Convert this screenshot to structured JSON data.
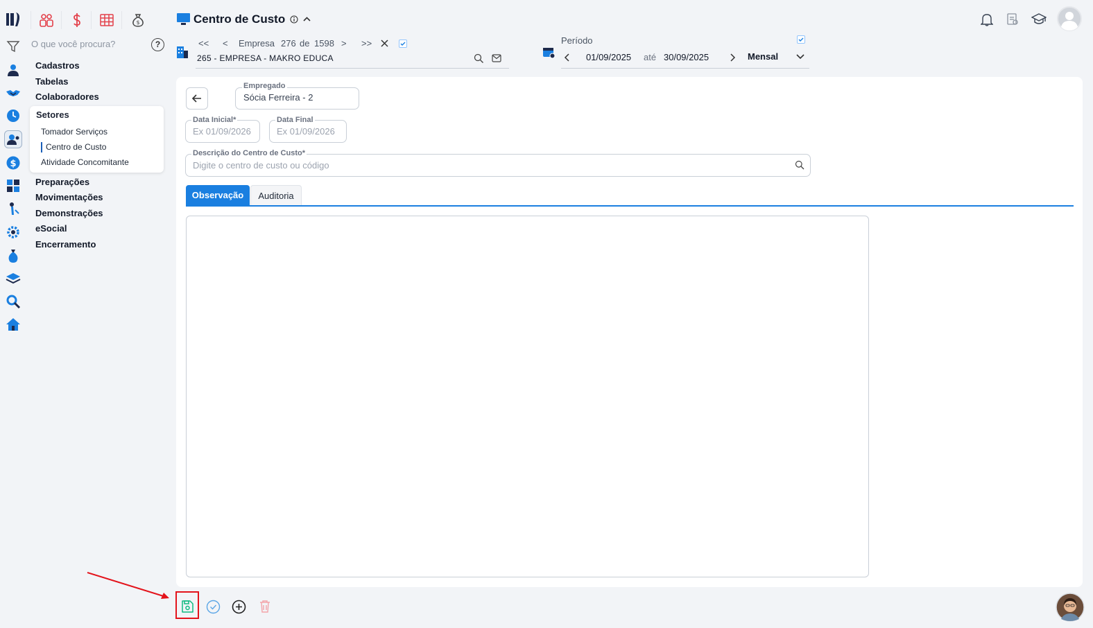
{
  "header": {
    "title": "Centro de Custo",
    "empresa": {
      "first": "<<",
      "prev": "<",
      "label": "Empresa",
      "index": "276",
      "of": "de",
      "total": "1598",
      "next": ">",
      "last": ">>",
      "name": "265 - EMPRESA - MAKRO EDUCA"
    },
    "periodo": {
      "label": "Período",
      "start": "01/09/2025",
      "sep": "até",
      "end": "30/09/2025",
      "mode": "Mensal"
    }
  },
  "search": {
    "placeholder": "O que você procura?",
    "help": "?"
  },
  "menu": {
    "cadastros": "Cadastros",
    "tabelas": "Tabelas",
    "colaboradores": "Colaboradores",
    "setores": {
      "title": "Setores",
      "items": [
        "Tomador Serviços",
        "Centro de Custo",
        "Atividade Concomitante"
      ]
    },
    "preparacoes": "Preparações",
    "movimentacoes": "Movimentações",
    "demonstracoes": "Demonstrações",
    "esocial": "eSocial",
    "encerramento": "Encerramento"
  },
  "form": {
    "empregado": {
      "label": "Empregado",
      "value": "Sócia Ferreira - 2"
    },
    "data_inicial": {
      "label": "Data Inicial*",
      "placeholder": "Ex 01/09/2026"
    },
    "data_final": {
      "label": "Data Final",
      "placeholder": "Ex 01/09/2026"
    },
    "descricao": {
      "label": "Descrição do Centro de Custo*",
      "placeholder": "Digite o centro de custo ou código"
    },
    "tabs": [
      "Observação",
      "Auditoria"
    ],
    "active_tab": "Observação",
    "observacao": ""
  },
  "colors": {
    "accent": "#1a7fe0",
    "brand_red": "#e3404a",
    "save_highlight": "#e3131b",
    "save_icon": "#10b981"
  },
  "icons": [
    "logo-icon",
    "users-icon",
    "dollar-icon",
    "grid-icon",
    "money-bag-icon",
    "filter-icon",
    "bell-icon",
    "report-icon",
    "graduation-cap-icon",
    "avatar-icon",
    "monitor-icon",
    "info-icon",
    "chevron-up-icon",
    "building-icon",
    "calendar-icon",
    "save-icon",
    "check-circle-icon",
    "plus-circle-icon",
    "trash-icon",
    "assistant-avatar-icon"
  ]
}
